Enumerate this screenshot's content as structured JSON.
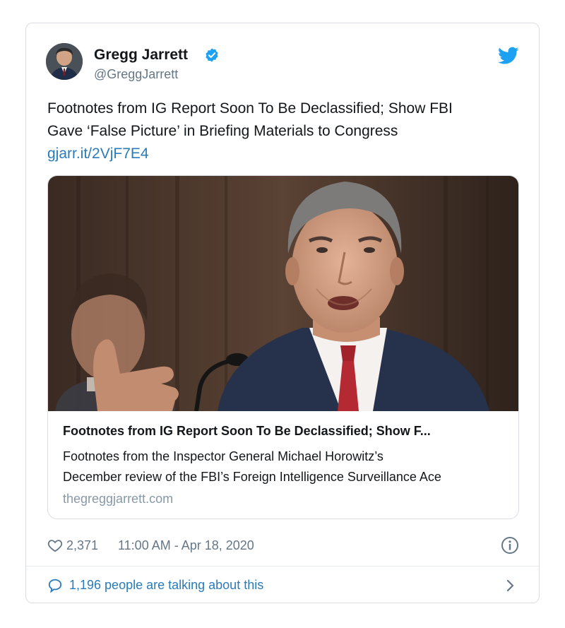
{
  "tweet": {
    "author_name": "Gregg Jarrett",
    "handle": "@GreggJarrett",
    "text_lines": [
      "Footnotes from IG Report Soon To Be Declassified; Show FBI",
      "Gave ‘False Picture’ in Briefing Materials to Congress"
    ],
    "link": "gjarr.it/2VjF7E4",
    "likes": "2,371",
    "timestamp": "11:00 AM - Apr 18, 2020",
    "conversation": "1,196 people are talking about this"
  },
  "link_preview": {
    "title": "Footnotes from IG Report Soon To Be Declassified; Show F...",
    "description_lines": [
      "Footnotes from the Inspector General Michael Horowitz’s",
      "December review of the FBI’s Foreign Intelligence Surveillance Ace"
    ],
    "domain": "thegreggjarrett.com"
  },
  "icons": {
    "verified": "verified-badge-icon",
    "brand": "twitter-bird-icon",
    "like": "heart-icon",
    "info": "info-icon",
    "reply": "speech-bubble-icon",
    "more": "chevron-right-icon"
  },
  "colors": {
    "link": "#2b7bb9",
    "verified": "#1da1f2",
    "muted": "#657786",
    "border": "#d9dde1"
  }
}
